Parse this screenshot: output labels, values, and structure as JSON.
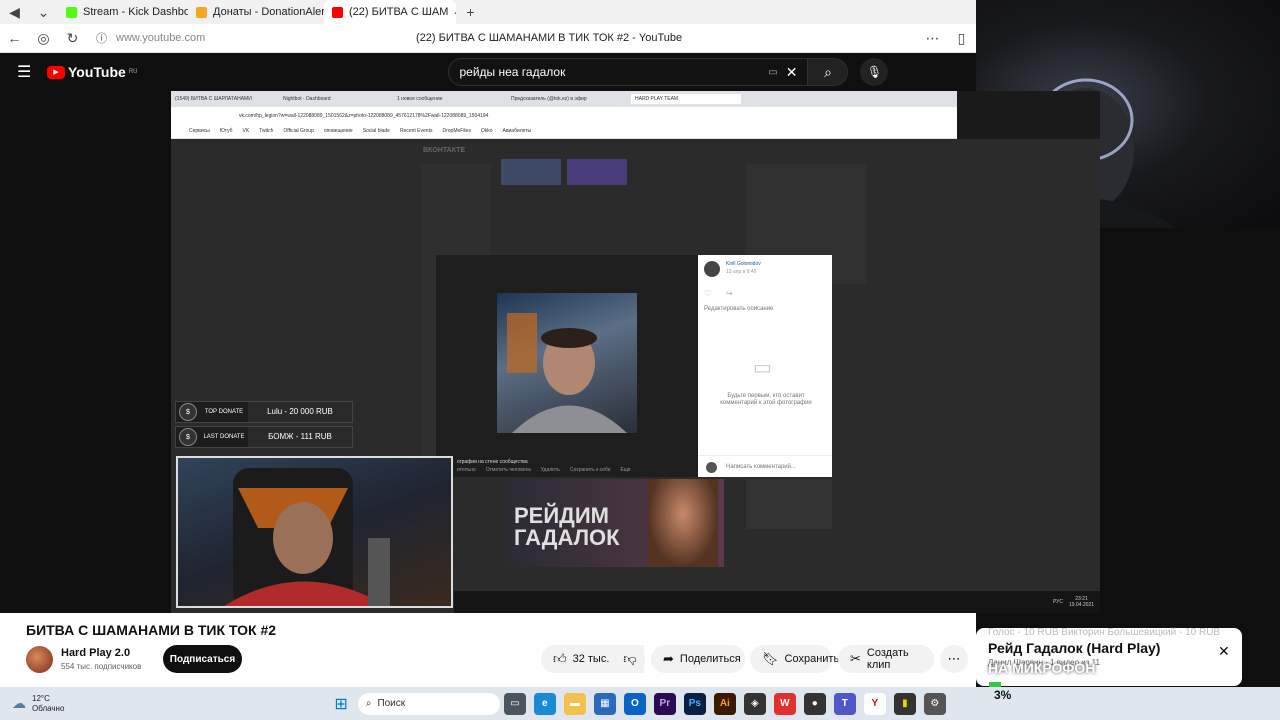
{
  "browser": {
    "tabs": [
      {
        "label": "Stream - Kick Dashboard",
        "color": "#53fc18"
      },
      {
        "label": "Донаты - DonationAlerts",
        "color": "#f5a623"
      },
      {
        "label": "(22) БИТВА С ШАМ",
        "color": "#ff0000"
      }
    ],
    "url": "www.youtube.com",
    "page_title": "(22) БИТВА С ШАМАНАМИ В ТИК ТОК #2 - YouTube"
  },
  "youtube": {
    "logo": "YouTube",
    "region": "RU",
    "search_value": "рейды неа гадалок"
  },
  "inner_browser": {
    "tabs": [
      "(1549) БИТВА С ШАРЛАТАНАМИ",
      "Nightbot - Dashboard",
      "1 новое сообщение",
      "Предсказатель (@tok.ez) в эфир",
      "HARD PLAY TEAM"
    ],
    "url": "vk.com/hp_legion?w=wall-122088089_1501562&z=photo-122088089_457612178%2Fwall-122088089_1504194",
    "bookmarks": [
      "Сервисы",
      "Ютуб",
      "VK",
      "Twitch",
      "Official Group",
      "оповещение",
      "Social blade",
      "Recent Events",
      "DropMeFiles",
      "Okko",
      "Авиабилеты"
    ],
    "vk_logo": "ВКОНТАКТЕ",
    "comment_author": "Kirill Golomidov",
    "comment_date": "13 апр в 9:40",
    "edit_desc": "Редактировать описание",
    "empty_comments": "Будьте первым, кто оставит комментарий к этой фотографии",
    "write_comment": "Написать комментарий...",
    "photo_caption": "ографии на стене сообщества",
    "photo_actions": [
      "ительно",
      "Отметить человека",
      "Удалить",
      "Сохранить к себе",
      "Ещё"
    ],
    "thumb_text": "РЕЙДИМ ГАДАЛОК",
    "clock_time": "23:21",
    "clock_date": "19.04.2021",
    "lang": "РУС"
  },
  "donations": {
    "top_label": "TOP DONATE",
    "top_value": "Lulu - 20 000 RUB",
    "last_label": "LAST DONATE",
    "last_value": "БОМЖ - 111 RUB"
  },
  "video_info": {
    "title": "БИТВА С ШАМАНАМИ В ТИК ТОК #2",
    "channel": "Hard Play 2.0",
    "subscribers": "554 тыс. подписчиков",
    "subscribe": "Подписаться",
    "likes": "32 тыс.",
    "share": "Поделиться",
    "save": "Сохранить",
    "clip": "Создать клип"
  },
  "overlay": {
    "playlist_title": "Рейд Гадалок (Hard Play)",
    "playlist_sub": "Данил Шарвин - 1 видео из 11",
    "ticker": "Голос - 10 RUB     Викторин Большевицкий - 10 RUB",
    "mic_banner": "НА МИКРОФОН",
    "percent": "3%"
  },
  "taskbar": {
    "temp": "12°C",
    "weather": "Облачно",
    "search": "Поиск"
  }
}
